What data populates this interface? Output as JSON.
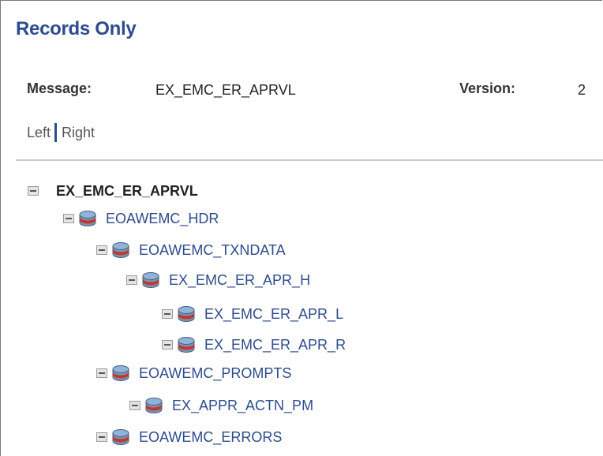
{
  "page": {
    "title": "Records Only"
  },
  "header": {
    "message_label": "Message:",
    "message_value": "EX_EMC_ER_APRVL",
    "version_label": "Version:",
    "version_value": "2"
  },
  "view_links": {
    "left": "Left",
    "right": "Right"
  },
  "tree": {
    "root": "EX_EMC_ER_APRVL",
    "records": [
      {
        "label": "EOAWEMC_HDR",
        "level": 1
      },
      {
        "label": "EOAWEMC_TXNDATA",
        "level": 2
      },
      {
        "label": "EX_EMC_ER_APR_H",
        "level": 3
      },
      {
        "label": "EX_EMC_ER_APR_L",
        "level": 4
      },
      {
        "label": "EX_EMC_ER_APR_R",
        "level": 4
      },
      {
        "label": "EOAWEMC_PROMPTS",
        "level": 2
      },
      {
        "label": "EX_APPR_ACTN_PM",
        "level": 3
      },
      {
        "label": "EOAWEMC_ERRORS",
        "level": 2
      }
    ]
  },
  "icons": {
    "collapse": "collapse-minus-icon",
    "record": "database-record-icon"
  },
  "colors": {
    "title": "#2d4b8e",
    "link": "#2d4b8e",
    "record_icon_top": "#8fb3d9",
    "record_icon_band": "#c0392b",
    "record_icon_body": "#7a93b4"
  }
}
